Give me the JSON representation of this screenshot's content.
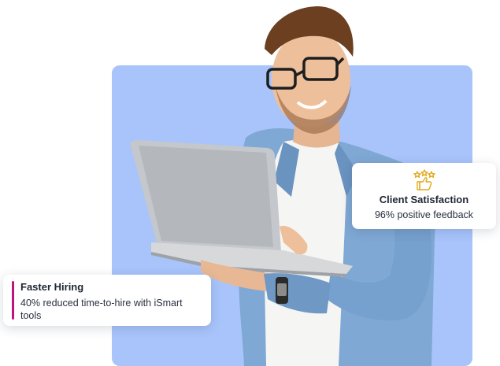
{
  "cards": {
    "satisfaction": {
      "icon": "thumbs-up-stars-icon",
      "title": "Client Satisfaction",
      "subtitle": "96% positive feedback"
    },
    "hiring": {
      "title": "Faster Hiring",
      "subtitle": "40% reduced time-to-hire with iSmart tools"
    }
  },
  "colors": {
    "panel_bg": "#a8c4fb",
    "accent_bar": "#c0147a",
    "icon_gold": "#e3a81b",
    "shirt": "#7fa8d4",
    "laptop": "#bfc2c6"
  },
  "image": {
    "subject": "man-with-laptop-photo"
  }
}
